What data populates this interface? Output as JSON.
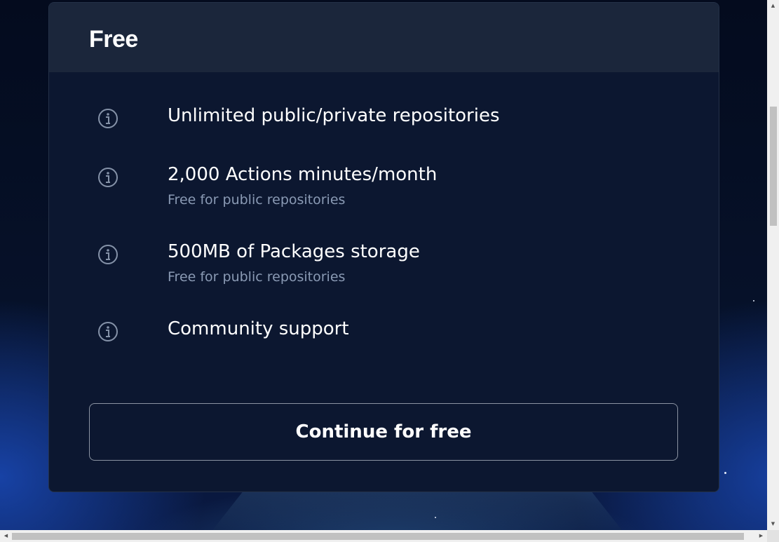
{
  "plan": {
    "title": "Free",
    "features": [
      {
        "label": "Unlimited public/private repositories",
        "sub": "",
        "icon": "info-icon"
      },
      {
        "label": "2,000 Actions minutes/month",
        "sub": "Free for public repositories",
        "icon": "info-icon"
      },
      {
        "label": "500MB of Packages storage",
        "sub": "Free for public repositories",
        "icon": "info-icon"
      },
      {
        "label": "Community support",
        "sub": "",
        "icon": "info-icon"
      }
    ],
    "cta_label": "Continue for free"
  },
  "scrollbars": {
    "up_arrow": "▲",
    "down_arrow": "▼",
    "left_arrow": "◀",
    "right_arrow": "▶"
  },
  "colors": {
    "card_bg": "#0c1730",
    "header_bg": "#1b263b",
    "subtext": "#8a9ab4",
    "button_border": "#8b94a2"
  }
}
